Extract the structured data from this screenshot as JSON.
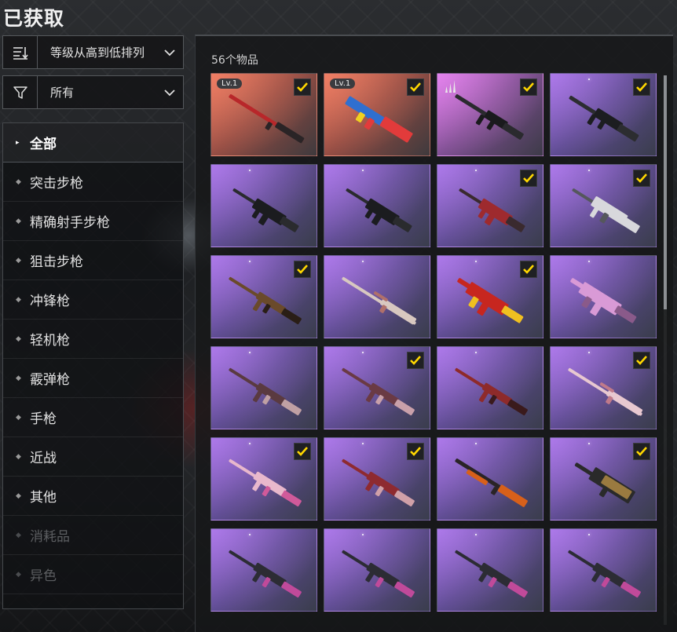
{
  "page_title": "已获取",
  "sort": {
    "label": "等级从高到低排列",
    "icon": "sort-icon"
  },
  "filter": {
    "label": "所有",
    "icon": "filter-icon"
  },
  "categories": [
    {
      "label": "全部",
      "active": true
    },
    {
      "label": "突击步枪"
    },
    {
      "label": "精确射手步枪"
    },
    {
      "label": "狙击步枪"
    },
    {
      "label": "冲锋枪"
    },
    {
      "label": "轻机枪"
    },
    {
      "label": "霰弹枪"
    },
    {
      "label": "手枪"
    },
    {
      "label": "近战"
    },
    {
      "label": "其他"
    },
    {
      "label": "消耗品",
      "disabled": true
    },
    {
      "label": "异色",
      "disabled": true
    }
  ],
  "item_count": "56个物品",
  "items": [
    {
      "bg": "red",
      "badge": "Lv.1",
      "checked": true,
      "gun": "rifle-long",
      "colors": [
        "#b8272a",
        "#2a2426"
      ]
    },
    {
      "bg": "red",
      "badge": "Lv.1",
      "checked": true,
      "gun": "ar-bulky",
      "colors": [
        "#2f6fd0",
        "#e23b3b"
      ]
    },
    {
      "bg": "magenta",
      "tier": true,
      "checked": true,
      "gun": "ar",
      "colors": [
        "#2a2a2e",
        "#1a1a1d"
      ]
    },
    {
      "bg": "purple",
      "checked": true,
      "gun": "scar",
      "colors": [
        "#2c2d30",
        "#1c1d20"
      ]
    },
    {
      "bg": "purple",
      "checked": false,
      "gun": "smg-bulky",
      "colors": [
        "#2a2b2e",
        "#1b1c1f"
      ]
    },
    {
      "bg": "purple",
      "checked": false,
      "gun": "smg-bulky",
      "colors": [
        "#2a2b2e",
        "#1b1c1f"
      ]
    },
    {
      "bg": "purple",
      "checked": true,
      "gun": "smg-bulky",
      "colors": [
        "#3a2a2e",
        "#9e2a2e"
      ]
    },
    {
      "bg": "purple",
      "checked": true,
      "gun": "g36",
      "colors": [
        "#d8d8dc",
        "#55575c"
      ]
    },
    {
      "bg": "purple",
      "checked": true,
      "gun": "ak",
      "colors": [
        "#6a4a2a",
        "#2a1e16"
      ]
    },
    {
      "bg": "purple",
      "checked": false,
      "gun": "sniper",
      "colors": [
        "#d8c8c0",
        "#b0706a"
      ]
    },
    {
      "bg": "purple",
      "checked": true,
      "gun": "ump",
      "colors": [
        "#c7261f",
        "#f0c020"
      ]
    },
    {
      "bg": "purple",
      "checked": false,
      "gun": "ump",
      "colors": [
        "#d99ad6",
        "#8a5a8a"
      ]
    },
    {
      "bg": "purple",
      "checked": false,
      "gun": "ak",
      "colors": [
        "#5a3a40",
        "#c0a0a4"
      ]
    },
    {
      "bg": "purple",
      "checked": true,
      "gun": "ak",
      "colors": [
        "#6a3a44",
        "#c9a0aa"
      ]
    },
    {
      "bg": "purple",
      "checked": false,
      "gun": "ak",
      "colors": [
        "#8e2a2a",
        "#3a1a1c"
      ]
    },
    {
      "bg": "purple",
      "checked": true,
      "gun": "sniper",
      "colors": [
        "#e8c8d0",
        "#c07a8a"
      ]
    },
    {
      "bg": "purple",
      "checked": true,
      "gun": "m416",
      "colors": [
        "#e8b8cc",
        "#d05a9a"
      ]
    },
    {
      "bg": "purple",
      "checked": true,
      "gun": "m416",
      "colors": [
        "#8e2a30",
        "#d0a0a8"
      ]
    },
    {
      "bg": "purple",
      "checked": false,
      "gun": "shotgun",
      "colors": [
        "#d8601a",
        "#2a2426"
      ]
    },
    {
      "bg": "purple",
      "checked": true,
      "gun": "famas",
      "colors": [
        "#2a2a2a",
        "#9a7a40"
      ]
    },
    {
      "bg": "purple",
      "checked": false,
      "gun": "m416",
      "colors": [
        "#2c2c34",
        "#c04a9a"
      ]
    },
    {
      "bg": "purple",
      "checked": false,
      "gun": "m416",
      "colors": [
        "#2c2c34",
        "#c04a9a"
      ]
    },
    {
      "bg": "purple",
      "checked": false,
      "gun": "m416",
      "colors": [
        "#2c2c34",
        "#c04a9a"
      ]
    },
    {
      "bg": "purple",
      "checked": false,
      "gun": "m416",
      "colors": [
        "#2c2c34",
        "#c04a9a"
      ]
    }
  ],
  "accent": "#ffd700"
}
